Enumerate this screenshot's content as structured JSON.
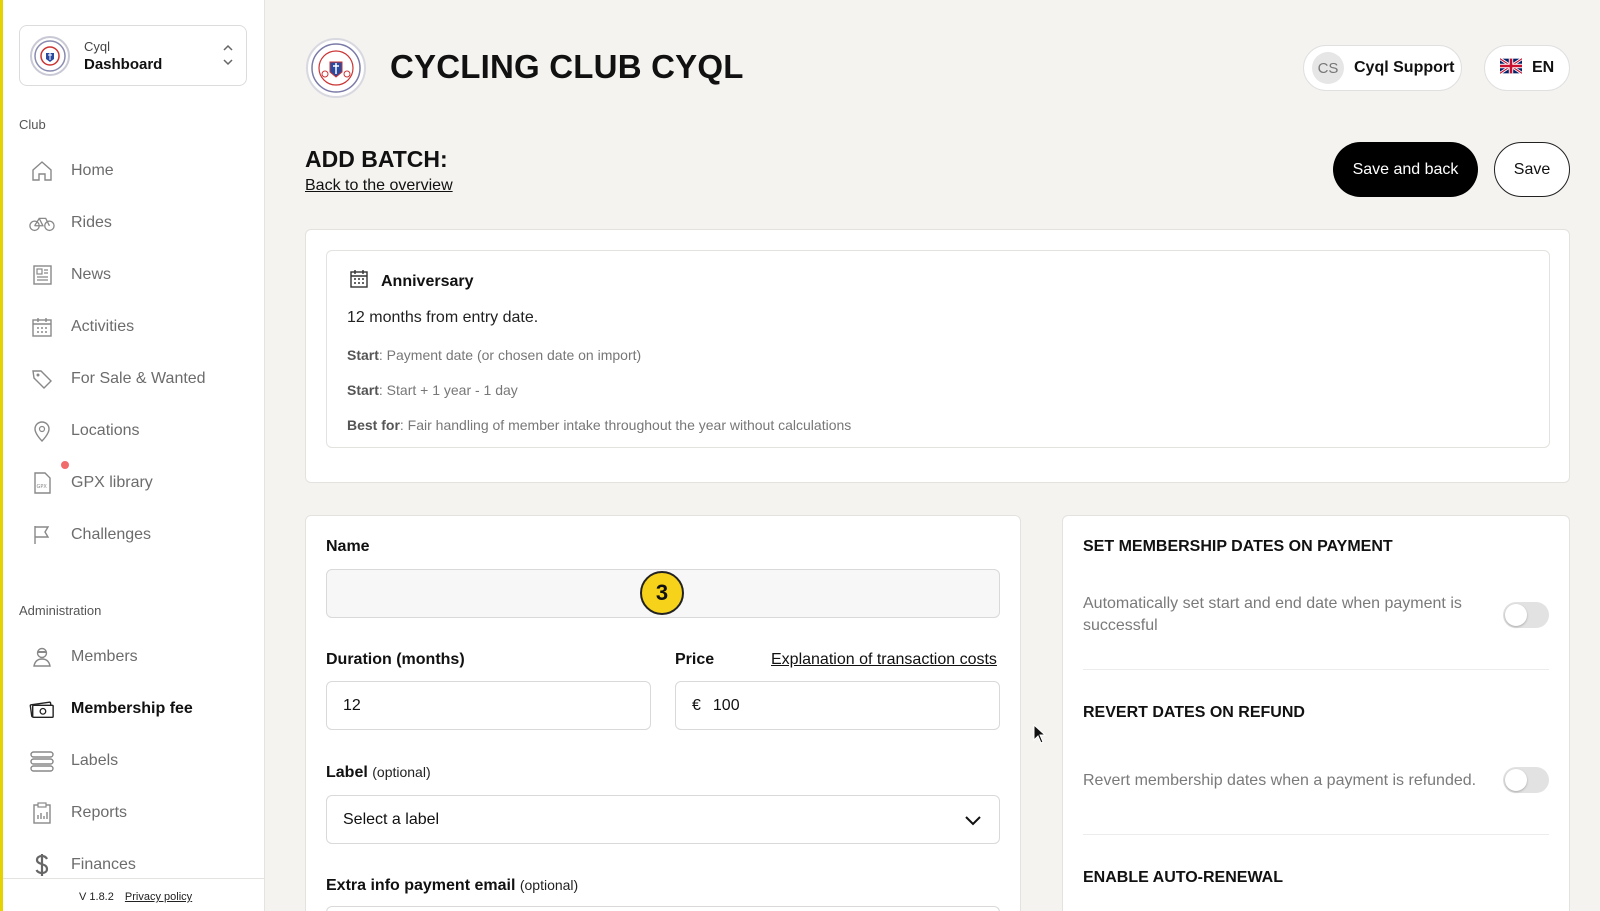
{
  "sidebar": {
    "switcher": {
      "org": "Cyql",
      "title": "Dashboard"
    },
    "club_section": "Club",
    "club_items": [
      {
        "label": "Home",
        "icon": "home-icon"
      },
      {
        "label": "Rides",
        "icon": "bicycle-icon"
      },
      {
        "label": "News",
        "icon": "newspaper-icon"
      },
      {
        "label": "Activities",
        "icon": "calendar-icon"
      },
      {
        "label": "For Sale & Wanted",
        "icon": "tag-icon"
      },
      {
        "label": "Locations",
        "icon": "location-pin-icon"
      },
      {
        "label": "GPX library",
        "icon": "gpx-file-icon"
      },
      {
        "label": "Challenges",
        "icon": "flag-icon"
      }
    ],
    "admin_section": "Administration",
    "admin_items": [
      {
        "label": "Members",
        "icon": "member-icon"
      },
      {
        "label": "Membership fee",
        "icon": "money-icon",
        "active": true
      },
      {
        "label": "Labels",
        "icon": "labels-icon"
      },
      {
        "label": "Reports",
        "icon": "clipboard-icon"
      },
      {
        "label": "Finances",
        "icon": "dollar-icon"
      }
    ],
    "footer": {
      "version": "V 1.8.2",
      "privacy": "Privacy policy"
    }
  },
  "header": {
    "club_name": "CYCLING CLUB CYQL",
    "support": {
      "initials": "CS",
      "name": "Cyql Support"
    },
    "language": {
      "code": "EN",
      "flag": "uk-flag-icon"
    }
  },
  "page": {
    "title": "ADD BATCH:",
    "back_link": "Back to the overview",
    "save_and_back": "Save and back",
    "save": "Save"
  },
  "membership_type": {
    "name": "Anniversary",
    "description": "12 months from entry date.",
    "lines": [
      {
        "key": "Start",
        "value": ": Payment date (or chosen date on import)"
      },
      {
        "key": "Start",
        "value": ": Start + 1 year - 1 day"
      },
      {
        "key": "Best for",
        "value": ": Fair handling of member intake throughout the year without calculations"
      }
    ]
  },
  "form": {
    "name_label": "Name",
    "name_value": "",
    "step_badge": "3",
    "duration_label": "Duration (months)",
    "duration_value": "12",
    "price_label": "Price",
    "price_currency": "€",
    "price_value": "100",
    "explanation_link": "Explanation of transaction costs",
    "label_label": "Label",
    "optional": "(optional)",
    "label_placeholder": "Select a label",
    "extra_info_label": "Extra info payment email"
  },
  "settings": [
    {
      "title": "SET MEMBERSHIP DATES ON PAYMENT",
      "description": "Automatically set start and end date when payment is successful",
      "enabled": false
    },
    {
      "title": "REVERT DATES ON REFUND",
      "description": "Revert membership dates when a payment is refunded.",
      "enabled": false
    },
    {
      "title": "ENABLE AUTO-RENEWAL"
    }
  ],
  "colors": {
    "accent": "#000000",
    "badge": "#f7d21a",
    "notification": "#f26b6b"
  }
}
